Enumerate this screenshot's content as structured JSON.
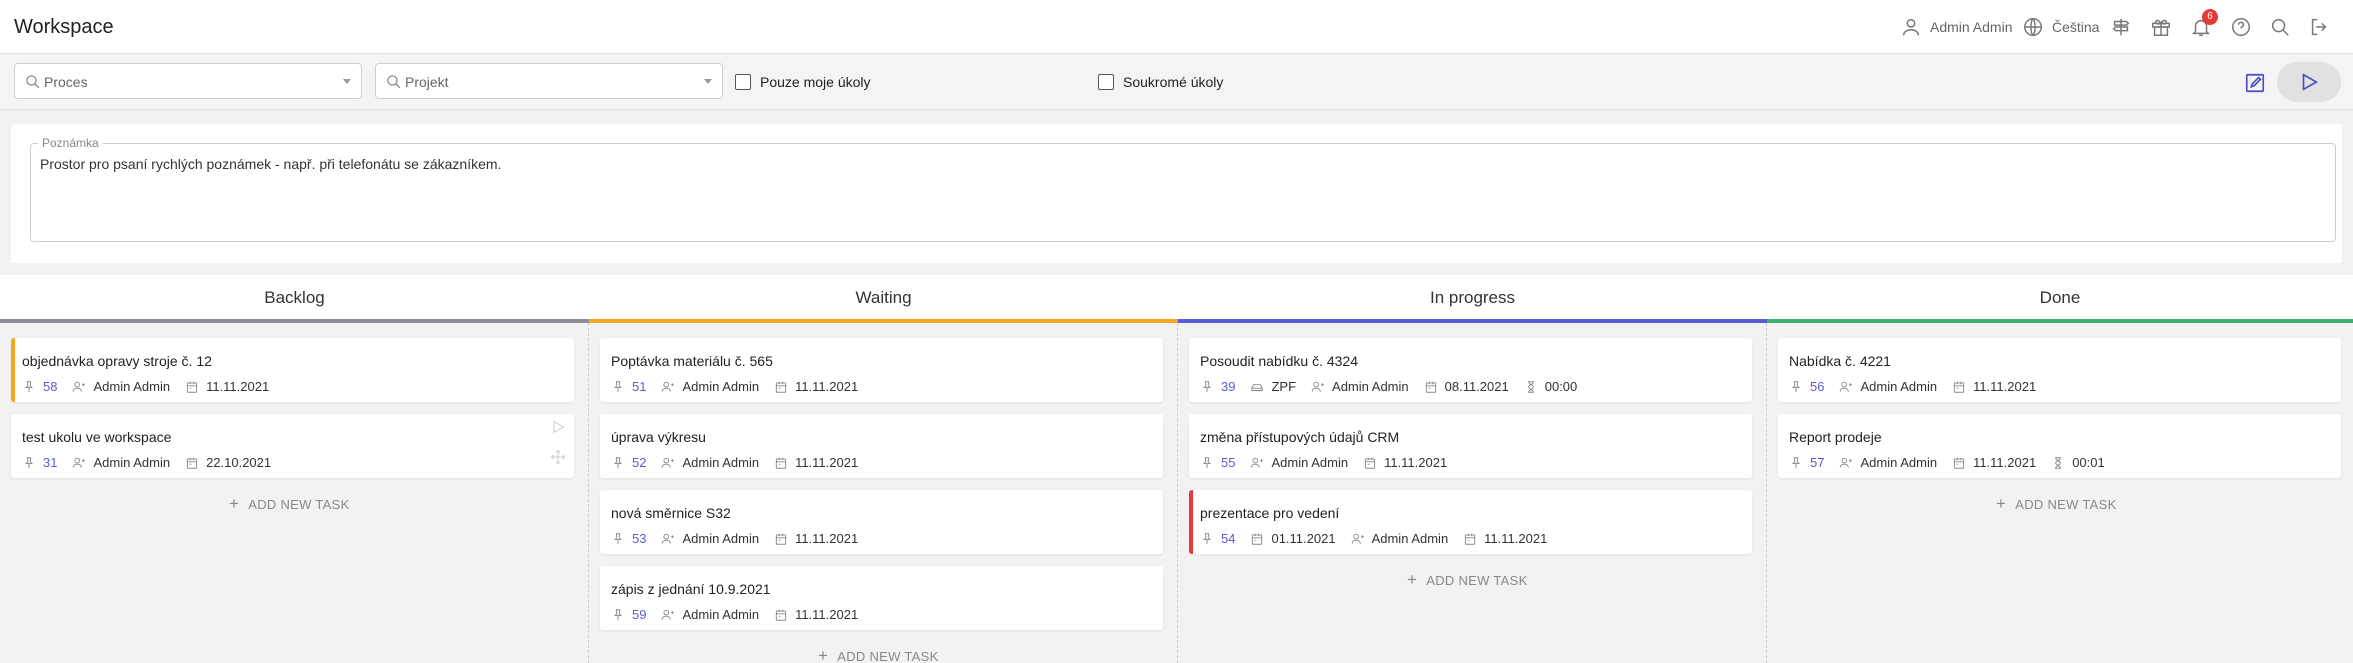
{
  "header": {
    "title": "Workspace",
    "user_name": "Admin Admin",
    "language": "Čeština",
    "notification_count": "6"
  },
  "filters": {
    "process_placeholder": "Proces",
    "project_placeholder": "Projekt",
    "only_my_tasks": "Pouze moje úkoly",
    "private_tasks": "Soukromé úkoly"
  },
  "note": {
    "label": "Poznámka",
    "text": "Prostor pro psaní rychlých poznámek - např. při telefonátu se zákazníkem."
  },
  "board": {
    "add_label": "ADD NEW TASK",
    "columns": [
      {
        "title": "Backlog",
        "color": "#8e8e94",
        "cards": [
          {
            "title": "objednávka opravy stroje č. 12",
            "id": "58",
            "user": "Admin Admin",
            "date": "11.11.2021",
            "accent": "#f5a623"
          },
          {
            "title": "test ukolu ve workspace",
            "id": "31",
            "user": "Admin Admin",
            "date": "22.10.2021"
          }
        ]
      },
      {
        "title": "Waiting",
        "color": "#f5a623",
        "cards": [
          {
            "title": "Poptávka materiálu č. 565",
            "id": "51",
            "user": "Admin Admin",
            "date": "11.11.2021"
          },
          {
            "title": "úprava výkresu",
            "id": "52",
            "user": "Admin Admin",
            "date": "11.11.2021"
          },
          {
            "title": "nová směrnice S32",
            "id": "53",
            "user": "Admin Admin",
            "date": "11.11.2021"
          },
          {
            "title": "zápis z jednání 10.9.2021",
            "id": "59",
            "user": "Admin Admin",
            "date": "11.11.2021"
          }
        ]
      },
      {
        "title": "In progress",
        "color": "#5b5bd6",
        "cards": [
          {
            "title": "Posoudit nabídku č. 4324",
            "id": "39",
            "tag": "ZPF",
            "user": "Admin Admin",
            "date": "08.11.2021",
            "time": "00:00"
          },
          {
            "title": "změna přístupových údajů CRM",
            "id": "55",
            "user": "Admin Admin",
            "date": "11.11.2021"
          },
          {
            "title": "prezentace pro vedení",
            "id": "54",
            "start": "01.11.2021",
            "user": "Admin Admin",
            "date": "11.11.2021",
            "accent": "#e53935"
          }
        ]
      },
      {
        "title": "Done",
        "color": "#3bb273",
        "cards": [
          {
            "title": "Nabídka č. 4221",
            "id": "56",
            "user": "Admin Admin",
            "date": "11.11.2021"
          },
          {
            "title": "Report prodeje",
            "id": "57",
            "user": "Admin Admin",
            "date": "11.11.2021",
            "time": "00:01"
          }
        ]
      }
    ]
  }
}
